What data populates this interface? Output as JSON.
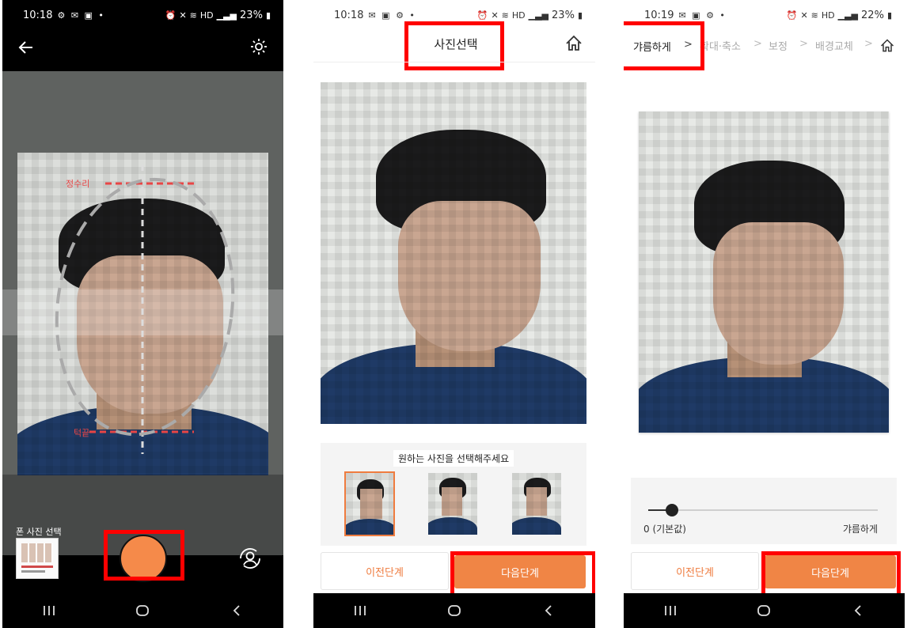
{
  "screens": [
    {
      "status": {
        "time": "10:18",
        "network": "HD",
        "battery": "23%"
      },
      "guides": {
        "top_label": "정수리",
        "bottom_label": "턱끝"
      },
      "gallery_label": "폰 사진 선택"
    },
    {
      "status": {
        "time": "10:18",
        "network": "HD",
        "battery": "23%"
      },
      "title": "사진선택",
      "select_prompt": "원하는 사진을 선택해주세요",
      "prev_label": "이전단계",
      "next_label": "다음단계"
    },
    {
      "status": {
        "time": "10:19",
        "network": "HD",
        "battery": "22%"
      },
      "steps": [
        {
          "label": "갸름하게"
        },
        {
          "label": "확대·축소"
        },
        {
          "label": "보정"
        },
        {
          "label": "배경교체"
        }
      ],
      "step_separator": ">",
      "slider": {
        "value": 0,
        "min_label": "0 (기본값)",
        "max_label": "갸름하게"
      },
      "prev_label": "이전단계",
      "next_label": "다음단계"
    }
  ],
  "colors": {
    "accent": "#f08545",
    "highlight": "#ff0000",
    "shirt": "#1f3a66"
  }
}
